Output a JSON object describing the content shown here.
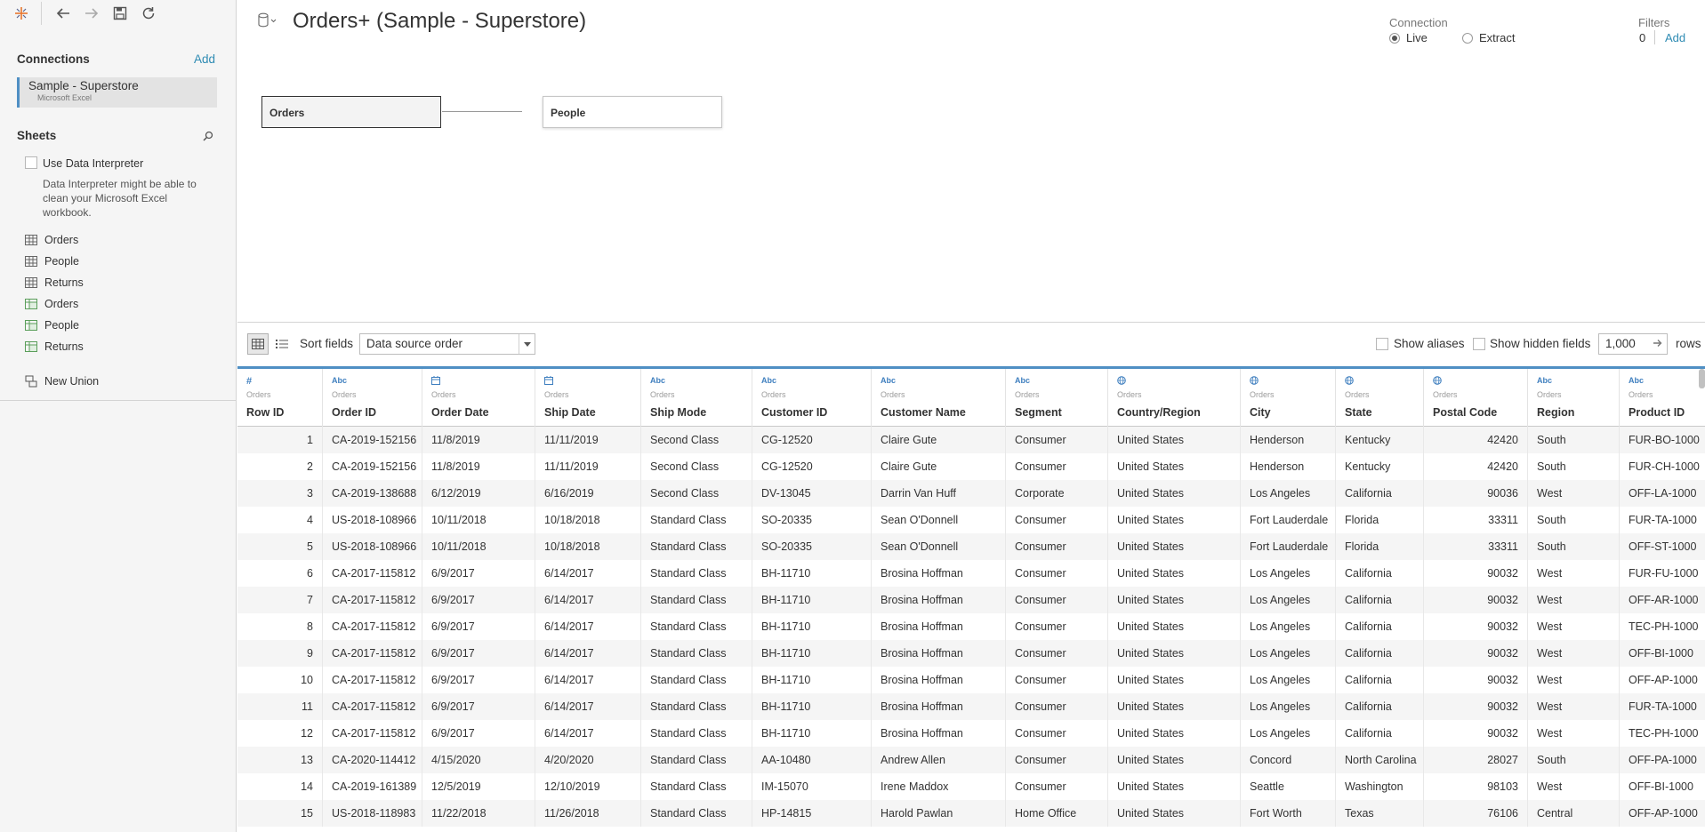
{
  "toolbar": {
    "icons": [
      "tableau-logo-icon",
      "back-icon",
      "forward-icon",
      "save-icon",
      "refresh-icon"
    ]
  },
  "connections": {
    "heading": "Connections",
    "add_label": "Add",
    "items": [
      {
        "name": "Sample - Superstore",
        "type": "Microsoft Excel"
      }
    ]
  },
  "sheets": {
    "heading": "Sheets",
    "use_interpreter_label": "Use Data Interpreter",
    "interpreter_note": "Data Interpreter might be able to clean your Microsoft Excel workbook.",
    "items": [
      {
        "name": "Orders",
        "icon": "table-icon"
      },
      {
        "name": "People",
        "icon": "table-icon"
      },
      {
        "name": "Returns",
        "icon": "table-icon"
      },
      {
        "name": "Orders",
        "icon": "named-range-icon"
      },
      {
        "name": "People",
        "icon": "named-range-icon"
      },
      {
        "name": "Returns",
        "icon": "named-range-icon"
      }
    ],
    "new_union_label": "New Union"
  },
  "canvas": {
    "title": "Orders+ (Sample - Superstore)",
    "connection_label": "Connection",
    "live_label": "Live",
    "extract_label": "Extract",
    "connection_mode": "Live",
    "filters_label": "Filters",
    "filters_count": "0",
    "filters_add": "Add",
    "tables": [
      "Orders",
      "People"
    ]
  },
  "grid_toolbar": {
    "sort_label": "Sort fields",
    "sort_value": "Data source order",
    "show_aliases_label": "Show aliases",
    "show_hidden_label": "Show hidden fields",
    "rows_value": "1,000",
    "rows_label": "rows"
  },
  "grid": {
    "columns": [
      {
        "type": "#",
        "source": "Orders",
        "name": "Row ID"
      },
      {
        "type": "Abc",
        "source": "Orders",
        "name": "Order ID"
      },
      {
        "type": "date",
        "source": "Orders",
        "name": "Order Date"
      },
      {
        "type": "date",
        "source": "Orders",
        "name": "Ship Date"
      },
      {
        "type": "Abc",
        "source": "Orders",
        "name": "Ship Mode"
      },
      {
        "type": "Abc",
        "source": "Orders",
        "name": "Customer ID"
      },
      {
        "type": "Abc",
        "source": "Orders",
        "name": "Customer Name"
      },
      {
        "type": "Abc",
        "source": "Orders",
        "name": "Segment"
      },
      {
        "type": "geo",
        "source": "Orders",
        "name": "Country/Region"
      },
      {
        "type": "geo",
        "source": "Orders",
        "name": "City"
      },
      {
        "type": "geo",
        "source": "Orders",
        "name": "State"
      },
      {
        "type": "geo",
        "source": "Orders",
        "name": "Postal Code"
      },
      {
        "type": "Abc",
        "source": "Orders",
        "name": "Region"
      },
      {
        "type": "Abc",
        "source": "Orders",
        "name": "Product ID"
      }
    ],
    "rows": [
      [
        "1",
        "CA-2019-152156",
        "11/8/2019",
        "11/11/2019",
        "Second Class",
        "CG-12520",
        "Claire Gute",
        "Consumer",
        "United States",
        "Henderson",
        "Kentucky",
        "42420",
        "South",
        "FUR-BO-1000"
      ],
      [
        "2",
        "CA-2019-152156",
        "11/8/2019",
        "11/11/2019",
        "Second Class",
        "CG-12520",
        "Claire Gute",
        "Consumer",
        "United States",
        "Henderson",
        "Kentucky",
        "42420",
        "South",
        "FUR-CH-1000"
      ],
      [
        "3",
        "CA-2019-138688",
        "6/12/2019",
        "6/16/2019",
        "Second Class",
        "DV-13045",
        "Darrin Van Huff",
        "Corporate",
        "United States",
        "Los Angeles",
        "California",
        "90036",
        "West",
        "OFF-LA-1000"
      ],
      [
        "4",
        "US-2018-108966",
        "10/11/2018",
        "10/18/2018",
        "Standard Class",
        "SO-20335",
        "Sean O'Donnell",
        "Consumer",
        "United States",
        "Fort Lauderdale",
        "Florida",
        "33311",
        "South",
        "FUR-TA-1000"
      ],
      [
        "5",
        "US-2018-108966",
        "10/11/2018",
        "10/18/2018",
        "Standard Class",
        "SO-20335",
        "Sean O'Donnell",
        "Consumer",
        "United States",
        "Fort Lauderdale",
        "Florida",
        "33311",
        "South",
        "OFF-ST-1000"
      ],
      [
        "6",
        "CA-2017-115812",
        "6/9/2017",
        "6/14/2017",
        "Standard Class",
        "BH-11710",
        "Brosina Hoffman",
        "Consumer",
        "United States",
        "Los Angeles",
        "California",
        "90032",
        "West",
        "FUR-FU-1000"
      ],
      [
        "7",
        "CA-2017-115812",
        "6/9/2017",
        "6/14/2017",
        "Standard Class",
        "BH-11710",
        "Brosina Hoffman",
        "Consumer",
        "United States",
        "Los Angeles",
        "California",
        "90032",
        "West",
        "OFF-AR-1000"
      ],
      [
        "8",
        "CA-2017-115812",
        "6/9/2017",
        "6/14/2017",
        "Standard Class",
        "BH-11710",
        "Brosina Hoffman",
        "Consumer",
        "United States",
        "Los Angeles",
        "California",
        "90032",
        "West",
        "TEC-PH-1000"
      ],
      [
        "9",
        "CA-2017-115812",
        "6/9/2017",
        "6/14/2017",
        "Standard Class",
        "BH-11710",
        "Brosina Hoffman",
        "Consumer",
        "United States",
        "Los Angeles",
        "California",
        "90032",
        "West",
        "OFF-BI-1000"
      ],
      [
        "10",
        "CA-2017-115812",
        "6/9/2017",
        "6/14/2017",
        "Standard Class",
        "BH-11710",
        "Brosina Hoffman",
        "Consumer",
        "United States",
        "Los Angeles",
        "California",
        "90032",
        "West",
        "OFF-AP-1000"
      ],
      [
        "11",
        "CA-2017-115812",
        "6/9/2017",
        "6/14/2017",
        "Standard Class",
        "BH-11710",
        "Brosina Hoffman",
        "Consumer",
        "United States",
        "Los Angeles",
        "California",
        "90032",
        "West",
        "FUR-TA-1000"
      ],
      [
        "12",
        "CA-2017-115812",
        "6/9/2017",
        "6/14/2017",
        "Standard Class",
        "BH-11710",
        "Brosina Hoffman",
        "Consumer",
        "United States",
        "Los Angeles",
        "California",
        "90032",
        "West",
        "TEC-PH-1000"
      ],
      [
        "13",
        "CA-2020-114412",
        "4/15/2020",
        "4/20/2020",
        "Standard Class",
        "AA-10480",
        "Andrew Allen",
        "Consumer",
        "United States",
        "Concord",
        "North Carolina",
        "28027",
        "South",
        "OFF-PA-1000"
      ],
      [
        "14",
        "CA-2019-161389",
        "12/5/2019",
        "12/10/2019",
        "Standard Class",
        "IM-15070",
        "Irene Maddox",
        "Consumer",
        "United States",
        "Seattle",
        "Washington",
        "98103",
        "West",
        "OFF-BI-1000"
      ],
      [
        "15",
        "US-2018-118983",
        "11/22/2018",
        "11/26/2018",
        "Standard Class",
        "HP-14815",
        "Harold Pawlan",
        "Home Office",
        "United States",
        "Fort Worth",
        "Texas",
        "76106",
        "Central",
        "OFF-AP-1000"
      ]
    ]
  },
  "colors": {
    "accent": "#4f8fc4",
    "link": "#2e8bb3",
    "type_icon": "#3f7fbf"
  }
}
